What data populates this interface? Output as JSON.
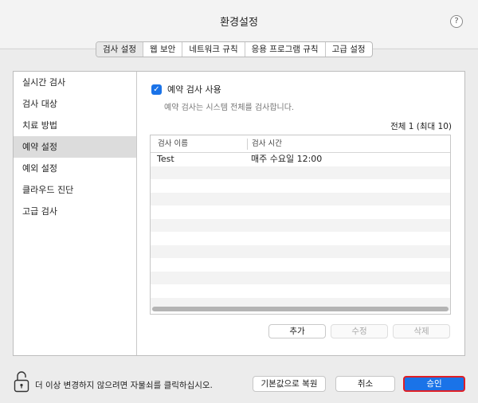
{
  "window": {
    "title": "환경설정"
  },
  "tabs": [
    {
      "label": "검사 설정",
      "active": true
    },
    {
      "label": "웹 보안"
    },
    {
      "label": "네트워크 규칙"
    },
    {
      "label": "응용 프로그램 규칙"
    },
    {
      "label": "고급 설정"
    }
  ],
  "sidebar": {
    "items": [
      {
        "label": "실시간 검사"
      },
      {
        "label": "검사 대상"
      },
      {
        "label": "치료 방법"
      },
      {
        "label": "예약 설정",
        "active": true
      },
      {
        "label": "예외 설정"
      },
      {
        "label": "클라우드 진단"
      },
      {
        "label": "고급 검사"
      }
    ]
  },
  "schedule": {
    "enable_label": "예약 검사 사용",
    "enable_checked": true,
    "description": "예약 검사는 시스템 전체를 검사합니다.",
    "count_label": "전체 1 (최대 10)",
    "columns": [
      "검사 이름",
      "검사 시간"
    ],
    "rows": [
      {
        "name": "Test",
        "time": "매주 수요일 12:00"
      }
    ],
    "buttons": {
      "add": "추가",
      "edit": "수정",
      "delete": "삭제"
    }
  },
  "footer": {
    "lock_hint": "더 이상 변경하지 않으려면 자물쇠를 클릭하십시오.",
    "restore_label": "기본값으로 복원",
    "cancel_label": "취소",
    "apply_label": "승인"
  },
  "colors": {
    "accent": "#1a73e8",
    "highlight": "#e01f26"
  },
  "icons": {
    "help": "help-icon",
    "lock": "lock-icon",
    "check": "checkmark-icon"
  }
}
